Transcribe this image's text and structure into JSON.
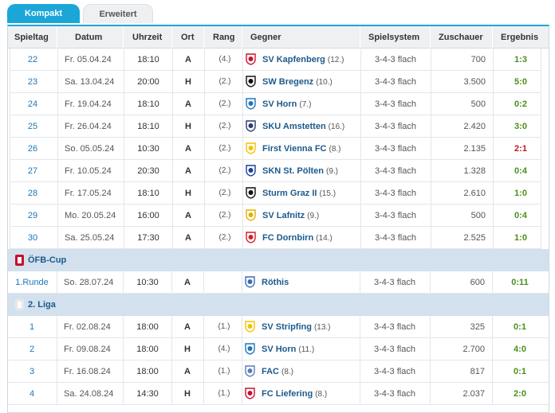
{
  "tabs": {
    "active": "Kompakt",
    "inactive": "Erweitert"
  },
  "columns": [
    "Spieltag",
    "Datum",
    "Uhrzeit",
    "Ort",
    "Rang",
    "Gegner",
    "Spielsystem",
    "Zuschauer",
    "Ergebnis"
  ],
  "league_rows": [
    {
      "md": "22",
      "date": "Fr. 05.04.24",
      "time": "18:10",
      "venue": "A",
      "rank": "(4.)",
      "team": "SV Kapfenberg",
      "team_rank": "(12.)",
      "system": "3-4-3 flach",
      "att": "700",
      "result": "1:3",
      "res_type": "win",
      "crest": "#c8102e"
    },
    {
      "md": "23",
      "date": "Sa. 13.04.24",
      "time": "20:00",
      "venue": "H",
      "rank": "(2.)",
      "team": "SW Bregenz",
      "team_rank": "(10.)",
      "system": "3-4-3 flach",
      "att": "3.500",
      "result": "5:0",
      "res_type": "win",
      "crest": "#111111"
    },
    {
      "md": "24",
      "date": "Fr. 19.04.24",
      "time": "18:10",
      "venue": "A",
      "rank": "(2.)",
      "team": "SV Horn",
      "team_rank": "(7.)",
      "system": "3-4-3 flach",
      "att": "500",
      "result": "0:2",
      "res_type": "win",
      "crest": "#1d77b8"
    },
    {
      "md": "25",
      "date": "Fr. 26.04.24",
      "time": "18:10",
      "venue": "H",
      "rank": "(2.)",
      "team": "SKU Amstetten",
      "team_rank": "(16.)",
      "system": "3-4-3 flach",
      "att": "2.420",
      "result": "3:0",
      "res_type": "win",
      "crest": "#2a3a6a"
    },
    {
      "md": "26",
      "date": "So. 05.05.24",
      "time": "10:30",
      "venue": "A",
      "rank": "(2.)",
      "team": "First Vienna FC",
      "team_rank": "(8.)",
      "system": "3-4-3 flach",
      "att": "2.135",
      "result": "2:1",
      "res_type": "loss",
      "crest": "#f2c200"
    },
    {
      "md": "27",
      "date": "Fr. 10.05.24",
      "time": "20:30",
      "venue": "A",
      "rank": "(2.)",
      "team": "SKN St. Pölten",
      "team_rank": "(9.)",
      "system": "3-4-3 flach",
      "att": "1.328",
      "result": "0:4",
      "res_type": "win",
      "crest": "#1c3f94"
    },
    {
      "md": "28",
      "date": "Fr. 17.05.24",
      "time": "18:10",
      "venue": "H",
      "rank": "(2.)",
      "team": "Sturm Graz II",
      "team_rank": "(15.)",
      "system": "3-4-3 flach",
      "att": "2.610",
      "result": "1:0",
      "res_type": "win",
      "crest": "#111111"
    },
    {
      "md": "29",
      "date": "Mo. 20.05.24",
      "time": "16:00",
      "venue": "A",
      "rank": "(2.)",
      "team": "SV Lafnitz",
      "team_rank": "(9.)",
      "system": "3-4-3 flach",
      "att": "500",
      "result": "0:4",
      "res_type": "win",
      "crest": "#e0b000"
    },
    {
      "md": "30",
      "date": "Sa. 25.05.24",
      "time": "17:30",
      "venue": "A",
      "rank": "(2.)",
      "team": "FC Dornbirn",
      "team_rank": "(14.)",
      "system": "3-4-3 flach",
      "att": "2.525",
      "result": "1:0",
      "res_type": "win",
      "crest": "#d2202a"
    }
  ],
  "cup": {
    "label": "ÖFB-Cup",
    "row": {
      "md": "1.Runde",
      "date": "So. 28.07.24",
      "time": "10:30",
      "venue": "A",
      "rank": "",
      "team": "Röthis",
      "team_rank": "",
      "system": "3-4-3 flach",
      "att": "600",
      "result": "0:11",
      "res_type": "win",
      "crest": "#3a6db3"
    }
  },
  "liga2": {
    "label": "2. Liga",
    "rows": [
      {
        "md": "1",
        "date": "Fr. 02.08.24",
        "time": "18:00",
        "venue": "A",
        "rank": "(1.)",
        "team": "SV Stripfing",
        "team_rank": "(13.)",
        "system": "3-4-3 flach",
        "att": "325",
        "result": "0:1",
        "res_type": "win",
        "crest": "#f2c200"
      },
      {
        "md": "2",
        "date": "Fr. 09.08.24",
        "time": "18:00",
        "venue": "H",
        "rank": "(4.)",
        "team": "SV Horn",
        "team_rank": "(11.)",
        "system": "3-4-3 flach",
        "att": "2.700",
        "result": "4:0",
        "res_type": "win",
        "crest": "#1d77b8"
      },
      {
        "md": "3",
        "date": "Fr. 16.08.24",
        "time": "18:00",
        "venue": "A",
        "rank": "(1.)",
        "team": "FAC",
        "team_rank": "(8.)",
        "system": "3-4-3 flach",
        "att": "817",
        "result": "0:1",
        "res_type": "win",
        "crest": "#5a7db8"
      },
      {
        "md": "4",
        "date": "Sa. 24.08.24",
        "time": "14:30",
        "venue": "H",
        "rank": "(1.)",
        "team": "FC Liefering",
        "team_rank": "(8.)",
        "system": "3-4-3 flach",
        "att": "2.037",
        "result": "2:0",
        "res_type": "win",
        "crest": "#c8102e"
      }
    ]
  }
}
